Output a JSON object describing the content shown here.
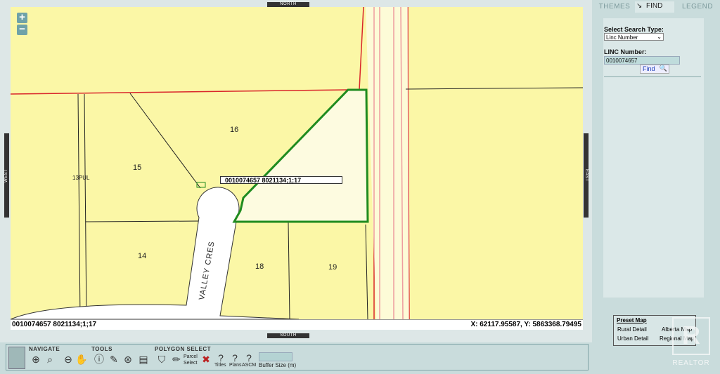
{
  "compass": {
    "north": "NORTH",
    "south": "SOUTH",
    "east": "EAST",
    "west": "WEST"
  },
  "zoom": {
    "in": "+",
    "out": "−"
  },
  "map": {
    "lot_labels": [
      "16",
      "15",
      "14",
      "18",
      "19"
    ],
    "side_label": "13PUL",
    "street": "VALLEY CRES",
    "callout": "0010074657 8021134;1;17"
  },
  "status": {
    "left": "0010074657 8021134;1;17",
    "coords": "X: 62117.95587, Y: 5863368.79495"
  },
  "toolbar": {
    "navigate": "NAVIGATE",
    "tools": "TOOLS",
    "polygon_select": "POLYGON SELECT",
    "parcel_select": "Parcel Select",
    "titles": "Titles",
    "plans": "Plans",
    "ascm": "ASCM",
    "buffer_size": "Buffer Size (m)"
  },
  "panel": {
    "tabs": {
      "themes": "THEMES",
      "find": "FIND",
      "legend": "LEGEND"
    },
    "search_type_label": "Select Search Type:",
    "search_type_value": "Linc Number",
    "linc_label": "LINC Number:",
    "linc_value": "0010074657",
    "find_button": "Find"
  },
  "preset": {
    "title": "Preset Map",
    "rural": "Rural Detail",
    "urban": "Urban Detail",
    "alberta": "Alberta Map",
    "regional": "Regional Map"
  },
  "watermark": {
    "text": "REALTOR"
  },
  "colors": {
    "parcel_fill": "#fbf7a6",
    "selected_outline": "#1f8b1f",
    "road_line": "#d9262b"
  }
}
